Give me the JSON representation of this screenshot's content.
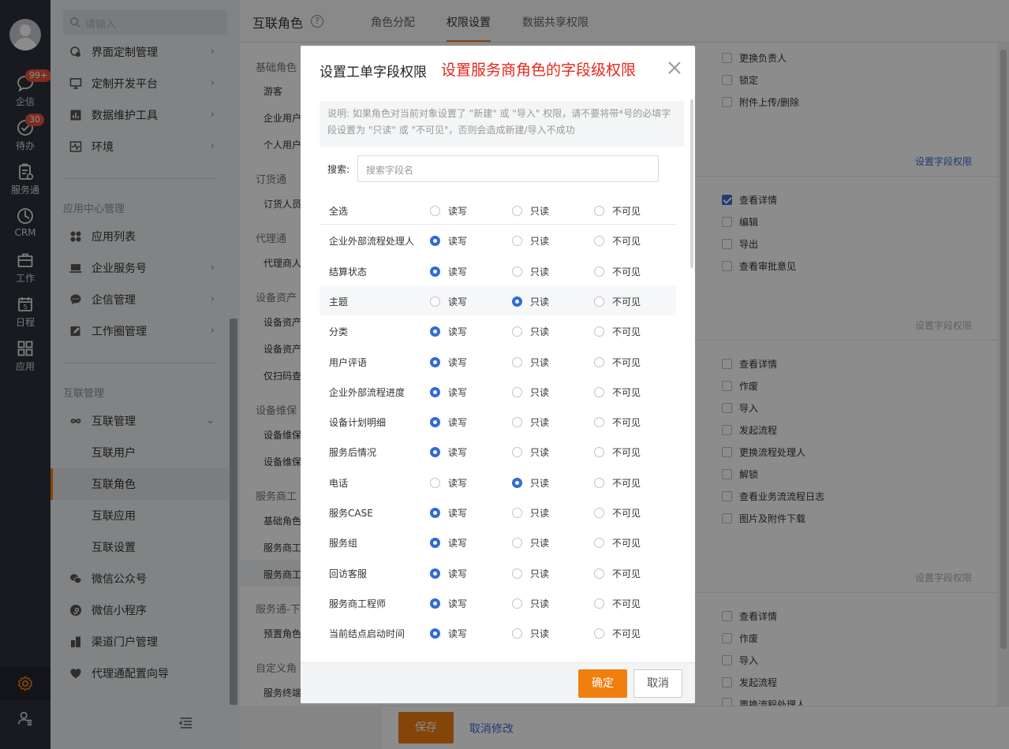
{
  "rail": {
    "items": [
      {
        "label": "企信",
        "badge": "99+"
      },
      {
        "label": "待办",
        "badge": "30"
      },
      {
        "label": "服务通"
      },
      {
        "label": "CRM"
      },
      {
        "label": "工作"
      },
      {
        "label": "日程",
        "day": "5"
      },
      {
        "label": "应用"
      }
    ]
  },
  "nav": {
    "search_placeholder": "请输入",
    "top_items": [
      "界面定制管理",
      "定制开发平台",
      "数据维护工具",
      "环境"
    ],
    "section_app": "应用中心管理",
    "app_items": [
      "应用列表",
      "企业服务号",
      "企信管理",
      "工作圈管理"
    ],
    "section_interconnect": "互联管理",
    "interconnect_group": "互联管理",
    "interconnect_sub": [
      "互联用户",
      "互联角色",
      "互联应用",
      "互联设置"
    ],
    "bottom_items": [
      "微信公众号",
      "微信小程序",
      "渠道门户管理",
      "代理通配置向导"
    ]
  },
  "header": {
    "title": "互联角色",
    "help": "?",
    "tabs": [
      "角色分配",
      "权限设置",
      "数据共享权限"
    ]
  },
  "roles": {
    "groups": [
      "基础角色",
      "订货通",
      "代理通",
      "设备资产",
      "设备维保",
      "服务商工",
      "服务通-下",
      "自定义角"
    ],
    "items": [
      "游客",
      "企业用户",
      "个人用户",
      "订货人员",
      "代理商人",
      "设备资产",
      "设备资产",
      "仅扫码查",
      "设备维保",
      "设备维保",
      "基础角色",
      "服务商工",
      "服务商工",
      "预置角色",
      "服务终端"
    ]
  },
  "perms": {
    "block1": [
      "更换负责人",
      "锁定",
      "附件上传/删除"
    ],
    "block2": [
      "查看详情",
      "编辑",
      "导出",
      "查看审批意见"
    ],
    "block3": [
      "查看详情",
      "作废",
      "导入",
      "发起流程",
      "更换流程处理人",
      "解锁",
      "查看业务流流程日志",
      "图片及附件下载"
    ],
    "block4": [
      "查看详情",
      "作废",
      "导入",
      "发起流程",
      "更换流程处理人"
    ],
    "field_link": "设置字段权限"
  },
  "footer": {
    "save": "保存",
    "cancel": "取消修改"
  },
  "modal": {
    "title": "设置工单字段权限",
    "annotation": "设置服务商角色的字段级权限",
    "note": "说明: 如果角色对当前对象设置了 \"新建\" 或 \"导入\" 权限，请不要将带*号的必填字段设置为 \"只读\" 或 \"不可见\"，否则会造成新建/导入不成功",
    "search_label": "搜索:",
    "search_placeholder": "搜索字段名",
    "options": [
      "读写",
      "只读",
      "不可见"
    ],
    "select_all": "全选",
    "fields": [
      {
        "name": "企业外部流程处理人",
        "value": 0
      },
      {
        "name": "结算状态",
        "value": 0
      },
      {
        "name": "主题",
        "value": 1
      },
      {
        "name": "分类",
        "value": 0
      },
      {
        "name": "用户评语",
        "value": 0
      },
      {
        "name": "企业外部流程进度",
        "value": 0
      },
      {
        "name": "设备计划明细",
        "value": 0
      },
      {
        "name": "服务后情况",
        "value": 0
      },
      {
        "name": "电话",
        "value": 1
      },
      {
        "name": "服务CASE",
        "value": 0
      },
      {
        "name": "服务组",
        "value": 0
      },
      {
        "name": "回访客服",
        "value": 0
      },
      {
        "name": "服务商工程师",
        "value": 0
      },
      {
        "name": "当前结点启动时间",
        "value": 0
      }
    ],
    "ok": "确定",
    "cancel": "取消"
  },
  "colors": {
    "accent": "#f07f10",
    "link": "#3b6fd0",
    "annotation": "#e8261a",
    "radio": "#2f6bd9"
  }
}
